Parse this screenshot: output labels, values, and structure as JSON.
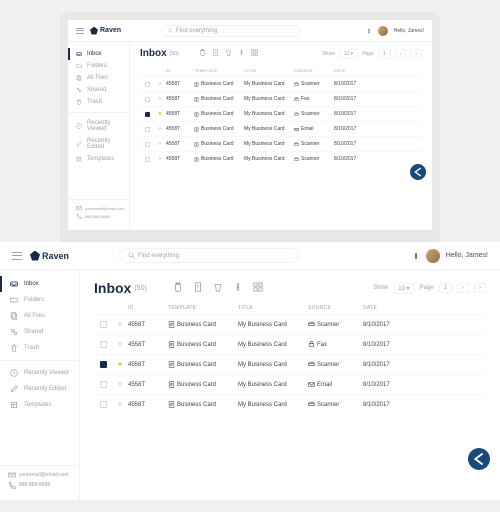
{
  "brand": "Raven",
  "search_placeholder": "Find everything",
  "user": "Hello, James!",
  "sidebar": {
    "primary": [
      {
        "label": "Inbox",
        "icon": "inbox"
      },
      {
        "label": "Folders",
        "icon": "folder"
      },
      {
        "label": "All Files",
        "icon": "files"
      },
      {
        "label": "Shared",
        "icon": "shared"
      },
      {
        "label": "Trash",
        "icon": "trash"
      }
    ],
    "secondary": [
      {
        "label": "Recently Viewed",
        "icon": "clock"
      },
      {
        "label": "Recently Edited",
        "icon": "pencil"
      },
      {
        "label": "Templates",
        "icon": "template"
      }
    ],
    "footer": {
      "email": "youremail@email.com",
      "phone": "888-888-8888"
    }
  },
  "page": {
    "title": "Inbox",
    "count": "(50)",
    "show_label": "Show",
    "show_value": "10",
    "page_label": "Page",
    "page_value": "1"
  },
  "columns": {
    "id": "ID",
    "template": "TEMPLATE",
    "title": "TITLE",
    "source": "SOURCE",
    "date": "DATE"
  },
  "rows": [
    {
      "checked": false,
      "starred": false,
      "id": "4558T",
      "template": "Business Card",
      "title": "My Business Card",
      "source": "Scanner",
      "date": "8/10/2017"
    },
    {
      "checked": false,
      "starred": false,
      "id": "4558T",
      "template": "Business Card",
      "title": "My Business Card",
      "source": "Fax",
      "date": "8/10/2017"
    },
    {
      "checked": true,
      "starred": true,
      "id": "4558T",
      "template": "Business Card",
      "title": "My Business Card",
      "source": "Scanner",
      "date": "8/10/2017"
    },
    {
      "checked": false,
      "starred": false,
      "id": "4558T",
      "template": "Business Card",
      "title": "My Business Card",
      "source": "Email",
      "date": "8/10/2017"
    },
    {
      "checked": false,
      "starred": false,
      "id": "4558T",
      "template": "Business Card",
      "title": "My Business Card",
      "source": "Scanner",
      "date": "8/10/2017"
    },
    {
      "checked": false,
      "starred": false,
      "id": "4558T",
      "template": "Business Card",
      "title": "My Business Card",
      "source": "Scanner",
      "date": "8/10/2017"
    }
  ]
}
